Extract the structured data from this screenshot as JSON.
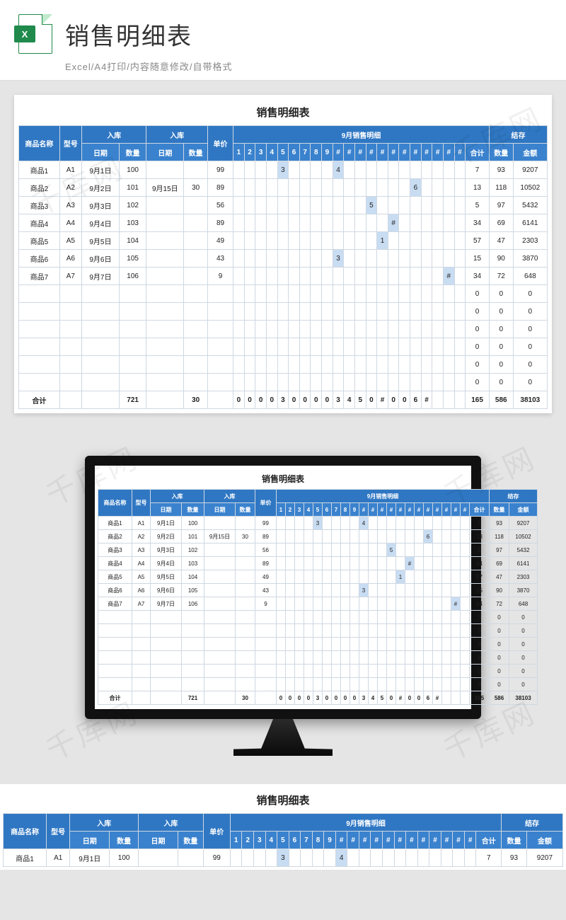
{
  "hero": {
    "icon_badge": "X",
    "title": "销售明细表",
    "subtitle": "Excel/A4打印/内容随意修改/自带格式"
  },
  "watermark": "千库网",
  "table": {
    "title": "销售明细表",
    "head": {
      "name": "商品名称",
      "model": "型号",
      "in1": "入库",
      "in2": "入库",
      "date": "日期",
      "qty": "数量",
      "price": "单价",
      "month": "9月销售明细",
      "sum": "合计",
      "stock": "结存",
      "stock_qty": "数量",
      "stock_amt": "金额",
      "total_row": "合计"
    },
    "day_labels": [
      "1",
      "2",
      "3",
      "4",
      "5",
      "6",
      "7",
      "8",
      "9",
      "#",
      "#",
      "#",
      "#",
      "#",
      "#",
      "#",
      "#",
      "#",
      "#",
      "#",
      "#"
    ],
    "rows": [
      {
        "name": "商品1",
        "model": "A1",
        "date1": "9月1日",
        "qty1": "100",
        "date2": "",
        "qty2": "",
        "price": "99",
        "days": [
          "",
          "",
          "",
          "",
          "3",
          "",
          "",
          "",
          "",
          "4",
          "",
          "",
          "",
          "",
          "",
          "",
          "",
          "",
          "",
          "",
          ""
        ],
        "hi": [
          4,
          9
        ],
        "sum": "7",
        "sq": "93",
        "amt": "9207"
      },
      {
        "name": "商品2",
        "model": "A2",
        "date1": "9月2日",
        "qty1": "101",
        "date2": "9月15日",
        "qty2": "30",
        "price": "89",
        "days": [
          "",
          "",
          "",
          "",
          "",
          "",
          "",
          "",
          "",
          "",
          "",
          "",
          "",
          "",
          "",
          "",
          "6",
          "",
          "",
          "",
          ""
        ],
        "hi": [
          16
        ],
        "sum": "13",
        "sq": "118",
        "amt": "10502"
      },
      {
        "name": "商品3",
        "model": "A3",
        "date1": "9月3日",
        "qty1": "102",
        "date2": "",
        "qty2": "",
        "price": "56",
        "days": [
          "",
          "",
          "",
          "",
          "",
          "",
          "",
          "",
          "",
          "",
          "",
          "",
          "5",
          "",
          "",
          "",
          "",
          "",
          "",
          "",
          ""
        ],
        "hi": [
          12
        ],
        "sum": "5",
        "sq": "97",
        "amt": "5432"
      },
      {
        "name": "商品4",
        "model": "A4",
        "date1": "9月4日",
        "qty1": "103",
        "date2": "",
        "qty2": "",
        "price": "89",
        "days": [
          "",
          "",
          "",
          "",
          "",
          "",
          "",
          "",
          "",
          "",
          "",
          "",
          "",
          "",
          "#",
          "",
          "",
          "",
          "",
          "",
          ""
        ],
        "hi": [
          14
        ],
        "sum": "34",
        "sq": "69",
        "amt": "6141"
      },
      {
        "name": "商品5",
        "model": "A5",
        "date1": "9月5日",
        "qty1": "104",
        "date2": "",
        "qty2": "",
        "price": "49",
        "days": [
          "",
          "",
          "",
          "",
          "",
          "",
          "",
          "",
          "",
          "",
          "",
          "",
          "",
          "1",
          "",
          "",
          "",
          "",
          "",
          "",
          ""
        ],
        "hi": [
          13
        ],
        "sum": "57",
        "sq": "47",
        "amt": "2303"
      },
      {
        "name": "商品6",
        "model": "A6",
        "date1": "9月6日",
        "qty1": "105",
        "date2": "",
        "qty2": "",
        "price": "43",
        "days": [
          "",
          "",
          "",
          "",
          "",
          "",
          "",
          "",
          "",
          "3",
          "",
          "",
          "",
          "",
          "",
          "",
          "",
          "",
          "",
          "",
          ""
        ],
        "hi": [
          9
        ],
        "sum": "15",
        "sq": "90",
        "amt": "3870"
      },
      {
        "name": "商品7",
        "model": "A7",
        "date1": "9月7日",
        "qty1": "106",
        "date2": "",
        "qty2": "",
        "price": "9",
        "days": [
          "",
          "",
          "",
          "",
          "",
          "",
          "",
          "",
          "",
          "",
          "",
          "",
          "",
          "",
          "",
          "",
          "",
          "",
          "",
          "#",
          ""
        ],
        "hi": [
          19
        ],
        "sum": "34",
        "sq": "72",
        "amt": "648"
      },
      {
        "name": "",
        "model": "",
        "date1": "",
        "qty1": "",
        "date2": "",
        "qty2": "",
        "price": "",
        "days": [
          "",
          "",
          "",
          "",
          "",
          "",
          "",
          "",
          "",
          "",
          "",
          "",
          "",
          "",
          "",
          "",
          "",
          "",
          "",
          "",
          ""
        ],
        "hi": [],
        "sum": "0",
        "sq": "0",
        "amt": "0"
      },
      {
        "name": "",
        "model": "",
        "date1": "",
        "qty1": "",
        "date2": "",
        "qty2": "",
        "price": "",
        "days": [
          "",
          "",
          "",
          "",
          "",
          "",
          "",
          "",
          "",
          "",
          "",
          "",
          "",
          "",
          "",
          "",
          "",
          "",
          "",
          "",
          ""
        ],
        "hi": [],
        "sum": "0",
        "sq": "0",
        "amt": "0"
      },
      {
        "name": "",
        "model": "",
        "date1": "",
        "qty1": "",
        "date2": "",
        "qty2": "",
        "price": "",
        "days": [
          "",
          "",
          "",
          "",
          "",
          "",
          "",
          "",
          "",
          "",
          "",
          "",
          "",
          "",
          "",
          "",
          "",
          "",
          "",
          "",
          ""
        ],
        "hi": [],
        "sum": "0",
        "sq": "0",
        "amt": "0"
      },
      {
        "name": "",
        "model": "",
        "date1": "",
        "qty1": "",
        "date2": "",
        "qty2": "",
        "price": "",
        "days": [
          "",
          "",
          "",
          "",
          "",
          "",
          "",
          "",
          "",
          "",
          "",
          "",
          "",
          "",
          "",
          "",
          "",
          "",
          "",
          "",
          ""
        ],
        "hi": [],
        "sum": "0",
        "sq": "0",
        "amt": "0"
      },
      {
        "name": "",
        "model": "",
        "date1": "",
        "qty1": "",
        "date2": "",
        "qty2": "",
        "price": "",
        "days": [
          "",
          "",
          "",
          "",
          "",
          "",
          "",
          "",
          "",
          "",
          "",
          "",
          "",
          "",
          "",
          "",
          "",
          "",
          "",
          "",
          ""
        ],
        "hi": [],
        "sum": "0",
        "sq": "0",
        "amt": "0"
      },
      {
        "name": "",
        "model": "",
        "date1": "",
        "qty1": "",
        "date2": "",
        "qty2": "",
        "price": "",
        "days": [
          "",
          "",
          "",
          "",
          "",
          "",
          "",
          "",
          "",
          "",
          "",
          "",
          "",
          "",
          "",
          "",
          "",
          "",
          "",
          "",
          ""
        ],
        "hi": [],
        "sum": "0",
        "sq": "0",
        "amt": "0"
      }
    ],
    "totals": {
      "qty1": "721",
      "qty2": "30",
      "days": [
        "0",
        "0",
        "0",
        "0",
        "3",
        "0",
        "0",
        "0",
        "0",
        "3",
        "4",
        "5",
        "0",
        "#",
        "0",
        "0",
        "6",
        "#",
        "",
        "",
        ""
      ],
      "sum": "165",
      "sq": "586",
      "amt": "38103"
    }
  }
}
